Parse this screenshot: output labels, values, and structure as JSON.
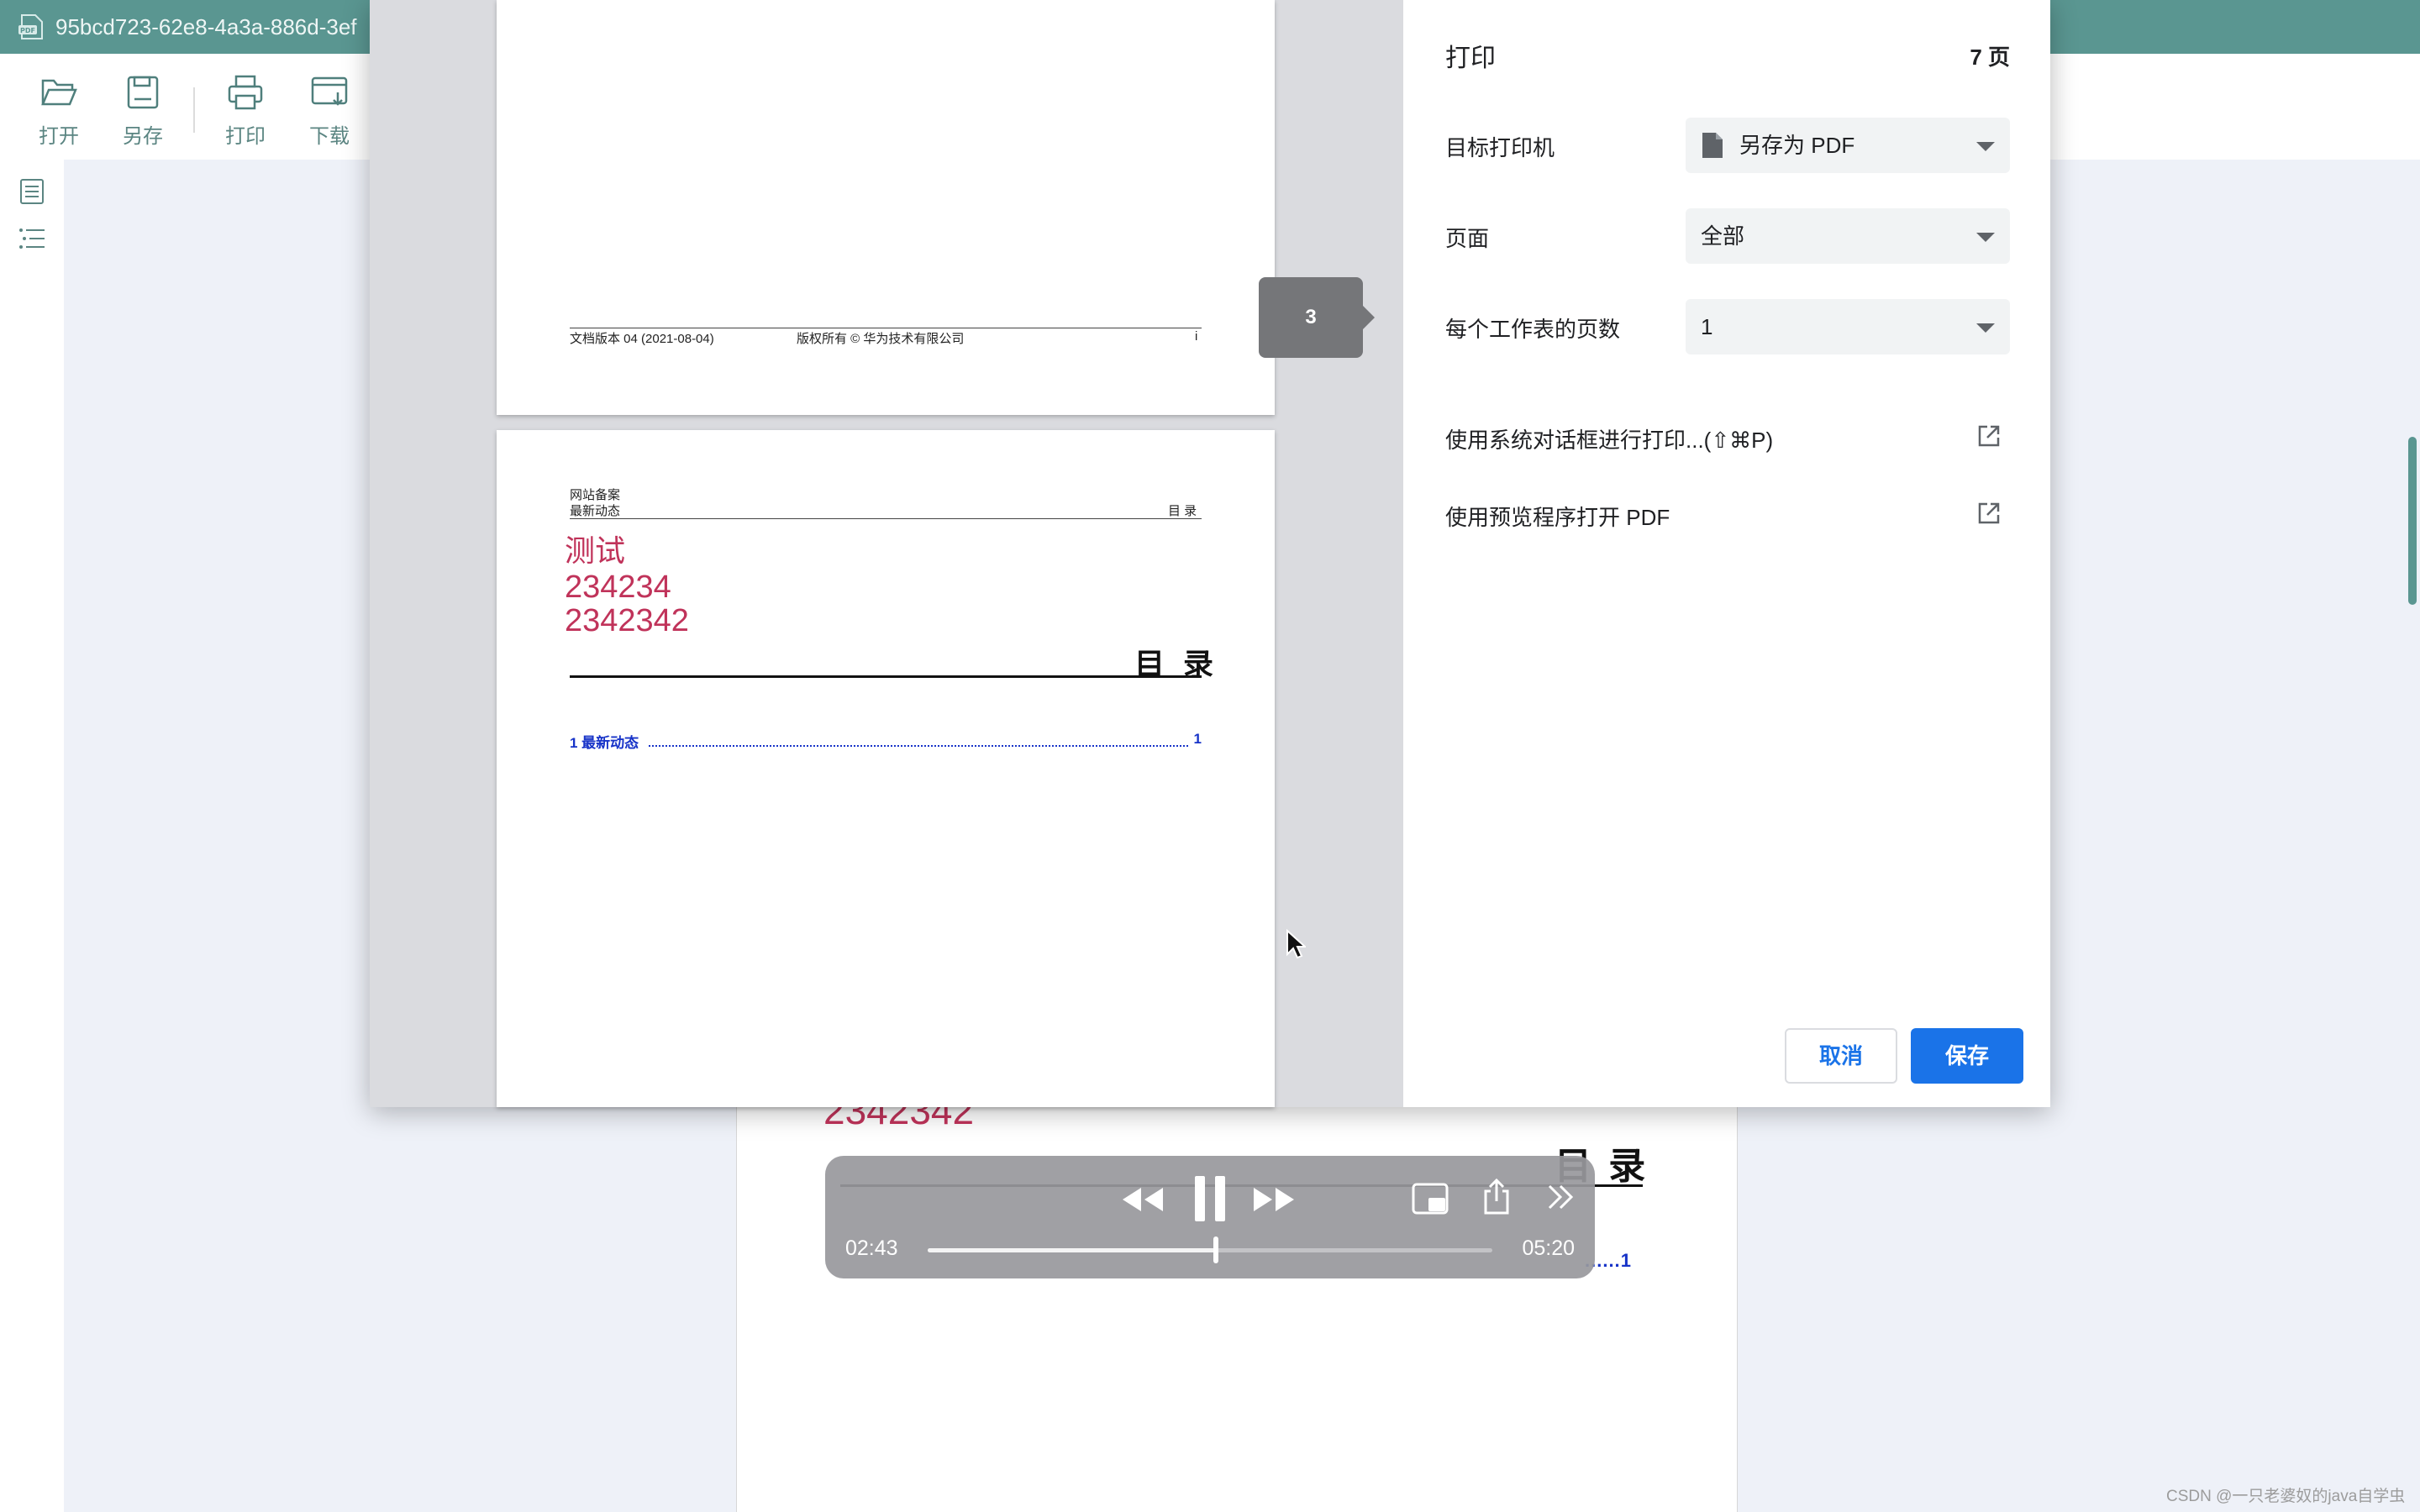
{
  "app": {
    "title": "95bcd723-62e8-4a3a-886d-3ef",
    "toolbar": [
      {
        "id": "open",
        "label": "打开",
        "icon": "folder-open-icon"
      },
      {
        "id": "saveas",
        "label": "另存",
        "icon": "save-icon"
      },
      {
        "id": "print",
        "label": "打印",
        "icon": "printer-icon"
      },
      {
        "id": "download",
        "label": "下载",
        "icon": "download-icon"
      }
    ]
  },
  "background_page": {
    "red_text": "2342342",
    "toc_title": "目 录",
    "toc_page": "1"
  },
  "preview": {
    "page1_footer": {
      "version": "文档版本 04 (2021-08-04)",
      "copyright": "版权所有 © 华为技术有限公司",
      "page_no": "i"
    },
    "page2": {
      "header_line1": "网站备案",
      "header_line2": "最新动态",
      "header_right": "目 录",
      "red_lines": [
        "测试",
        "234234",
        "2342342"
      ],
      "toc_title": "目 录",
      "toc_entry": "1 最新动态",
      "toc_entry_page": "1"
    },
    "page_badge": "3"
  },
  "print_panel": {
    "title": "打印",
    "page_count": "7 页",
    "destination_label": "目标打印机",
    "destination_value": "另存为 PDF",
    "pages_label": "页面",
    "pages_value": "全部",
    "per_sheet_label": "每个工作表的页数",
    "per_sheet_value": "1",
    "system_dialog_link": "使用系统对话框进行打印...(⇧⌘P)",
    "preview_app_link": "使用预览程序打开 PDF",
    "cancel_label": "取消",
    "save_label": "保存"
  },
  "media": {
    "current_time": "02:43",
    "duration": "05:20",
    "progress": 0.51
  },
  "watermark": "CSDN @一只老婆奴的java自学虫",
  "colors": {
    "titlebar": "#5a9691",
    "accent_blue": "#1a73e8",
    "red_text": "#c0335a",
    "toc_blue": "#1733c8"
  }
}
